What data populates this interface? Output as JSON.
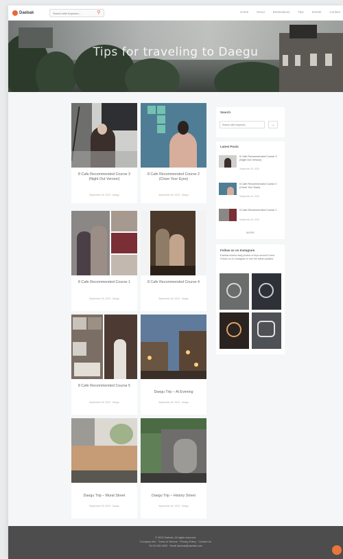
{
  "site": {
    "logo_text": "Daebak",
    "search_placeholder": "Search with Keyword...",
    "search_icon": "search-icon",
    "menu": [
      "Home",
      "Seoul",
      "Destinations",
      "Tips",
      "Events",
      "Contact"
    ]
  },
  "hero": {
    "title": "Tips for traveling to Daegu"
  },
  "posts": [
    {
      "title": "8 Cafe Recommended Course 3 (Night Out Version)",
      "meta": "September 25, 2023 · Daegu"
    },
    {
      "title": "8 Cafe Recommended Course 2 (Close Your Eyes)",
      "meta": "September 25, 2023 · Daegu"
    },
    {
      "title": "8 Cafe Recommended Course 1",
      "meta": "September 25, 2023 · Daegu"
    },
    {
      "title": "8 Cafe Recommended Course 4",
      "meta": "September 25, 2023 · Daegu"
    },
    {
      "title": "8 Cafe Recommended Course 5",
      "meta": "September 25, 2023 · Daegu"
    },
    {
      "title": "Daegu Trip – At Evening",
      "meta": "September 25, 2023 · Daegu"
    },
    {
      "title": "Daegu Trip – Mural Street",
      "meta": "September 25, 2023 · Daegu"
    },
    {
      "title": "Daegu Trip – History Street",
      "meta": "September 25, 2023 · Daegu"
    }
  ],
  "sidebar": {
    "search": {
      "title": "Search",
      "placeholder": "Search with Keyword...",
      "button_icon": "arrow-right-icon"
    },
    "latest": {
      "title": "Latest Posts",
      "items": [
        {
          "title": "8 Cafe Recommended Course 3 (Night Out Version)",
          "date": "September 25, 2023"
        },
        {
          "title": "8 Cafe Recommended Course 2 (Close Your Eyes)",
          "date": "September 25, 2023"
        },
        {
          "title": "8 Cafe Recommended Course 1",
          "date": "September 25, 2023"
        }
      ],
      "more_label": "MORE"
    },
    "instagram": {
      "title": "Follow us on Instagram",
      "text": "Daebak shares daily photos of trips around Korea. Follow us on Instagram to see the latest updates."
    }
  },
  "footer": {
    "lines": [
      "© 2023 Daebak. All rights reserved.",
      "Company Info · Terms of Service · Privacy Policy · Contact Us",
      "Tel 02-000-0000 · Email daebak@daebak.com"
    ]
  },
  "colors": {
    "accent": "#e8663a",
    "footer": "#4d4d4d",
    "background": "#f4f6f7"
  }
}
